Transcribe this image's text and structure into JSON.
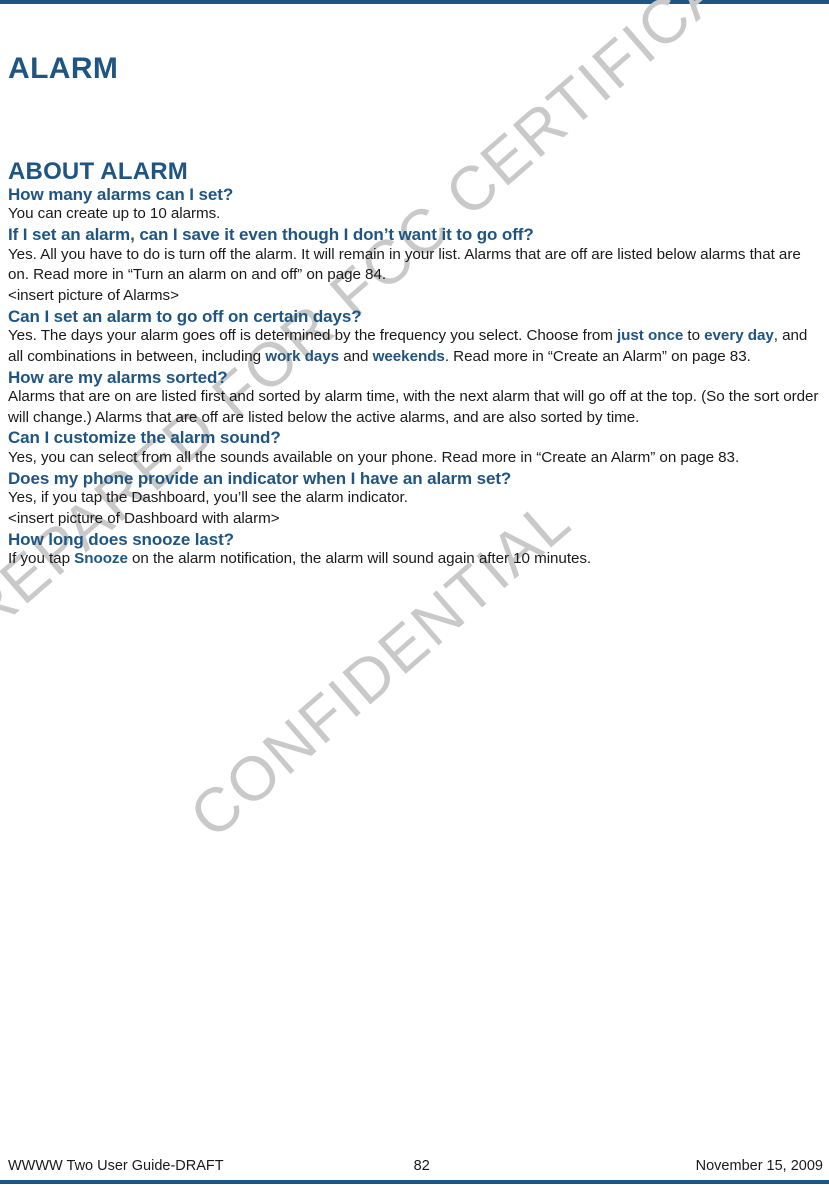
{
  "document": {
    "chapter_title": "ALARM",
    "section_title": "ABOUT ALARM",
    "accent_color": "#1F5582",
    "watermark_color": "#C9C9C9"
  },
  "watermarks": [
    {
      "text": "PREPARED FOR FCC CERTIFICATION"
    },
    {
      "text": "CONFIDENTIAL"
    }
  ],
  "faqs": [
    {
      "question": "How many alarms can I set?",
      "answer_1": "You can create up to 10 alarms."
    },
    {
      "question": "If I set an alarm, can I save it even though I don’t want it to go off?",
      "answer_1": "Yes. All you have to do is turn off the alarm. It will remain in your list. Alarms that are off are listed below alarms that are on. Read more in “Turn an alarm on and off” on page 84.",
      "note": "<insert picture of Alarms>"
    },
    {
      "question": "Can I set an alarm to go off on certain days?",
      "answer_parts": {
        "p1": "Yes. The days your alarm goes off is determined by the frequency you select. Choose from ",
        "kw1": "just once",
        "p2": " to ",
        "kw2": "every day",
        "p3": ", and all combinations in between, including ",
        "kw3": "work days",
        "p4": " and ",
        "kw4": "weekends",
        "p5": ". Read more in “Create an Alarm” on page 83."
      }
    },
    {
      "question": "How are my alarms sorted?",
      "answer_1": "Alarms that are on are listed first and sorted by alarm time, with the next alarm that will go off at the top. (So the sort order will change.) Alarms that are off are listed below the active alarms, and are also sorted by time."
    },
    {
      "question": "Can I customize the alarm sound?",
      "answer_1": "Yes, you can select from all the sounds available on your phone. Read more in “Create an Alarm” on page 83."
    },
    {
      "question": "Does my phone provide an indicator when I have an alarm set?",
      "answer_1": "Yes, if you tap the Dashboard, you’ll see the alarm indicator.",
      "note": "<insert picture of Dashboard with alarm>"
    },
    {
      "question": "How long does snooze last?",
      "answer_parts": {
        "p1": "If you tap ",
        "kw1": "Snooze",
        "p2": " on the alarm notification, the alarm will sound again after 10 minutes."
      }
    }
  ],
  "footer": {
    "left": "WWWW Two User Guide-DRAFT",
    "page_number": "82",
    "right": "November 15, 2009"
  }
}
